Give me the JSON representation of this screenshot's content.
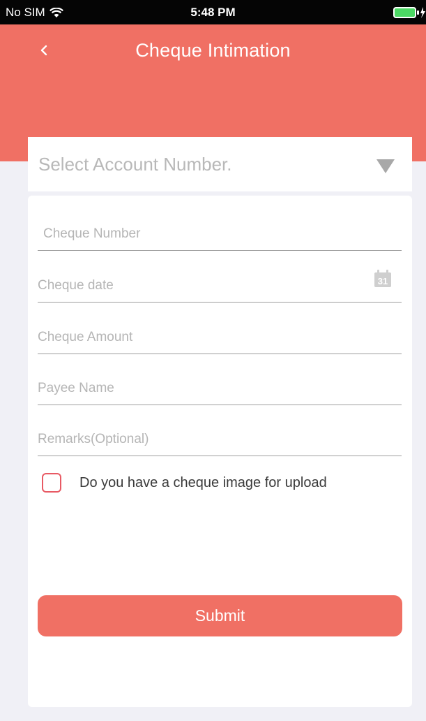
{
  "status_bar": {
    "carrier": "No SIM",
    "time": "5:48 PM"
  },
  "header": {
    "title": "Cheque Intimation"
  },
  "account_select": {
    "placeholder": "Select Account Number."
  },
  "form": {
    "fields": [
      {
        "placeholder": "Cheque Number"
      },
      {
        "placeholder": "Cheque date",
        "icon": "calendar-icon",
        "icon_text": "31"
      },
      {
        "placeholder": "Cheque Amount"
      },
      {
        "placeholder": "Payee Name"
      },
      {
        "placeholder": "Remarks(Optional)"
      }
    ],
    "upload_checkbox_label": "Do you have a cheque image for upload",
    "upload_checked": false
  },
  "submit_label": "Submit",
  "colors": {
    "primary": "#f07064",
    "checkbox_border": "#e85a64",
    "page_background": "#f0f0f6"
  }
}
